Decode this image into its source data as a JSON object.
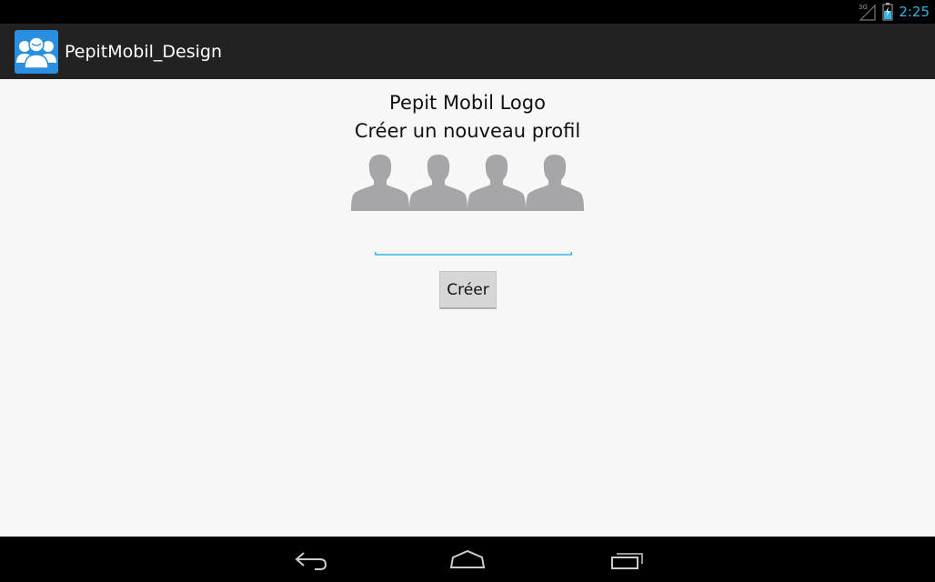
{
  "status_bar": {
    "network_label": "3G",
    "time": "2:25",
    "signal_icon": "signal-icon",
    "battery_icon": "battery-icon",
    "accent_color": "#33b5e5"
  },
  "action_bar": {
    "app_title": "PepitMobil_Design",
    "app_icon": "people-group-icon",
    "background": "#222222"
  },
  "main": {
    "logo_text": "Pepit Mobil Logo",
    "subtitle": "Créer un nouveau profil",
    "avatars": [
      {
        "icon": "person-silhouette-icon"
      },
      {
        "icon": "person-silhouette-icon"
      },
      {
        "icon": "person-silhouette-icon"
      },
      {
        "icon": "person-silhouette-icon"
      }
    ],
    "name_field": {
      "value": "",
      "placeholder": "",
      "underline_color": "#33b5e5"
    },
    "create_button_label": "Créer"
  },
  "nav_bar": {
    "back_icon": "back-icon",
    "home_icon": "home-icon",
    "recents_icon": "recent-apps-icon"
  }
}
